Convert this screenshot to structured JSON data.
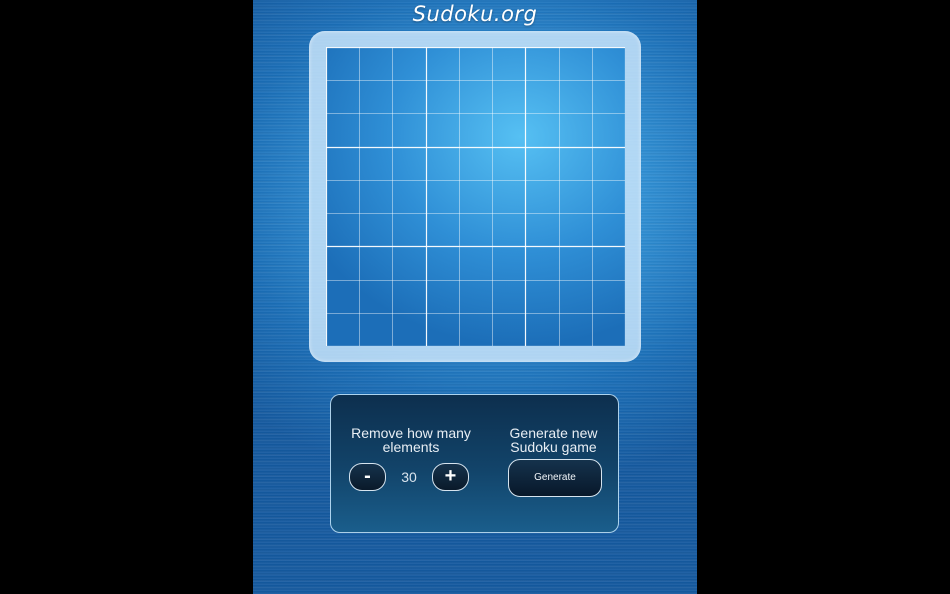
{
  "app": {
    "title": "Sudoku.org"
  },
  "board": {
    "rows": 9,
    "cols": 9,
    "cells": [
      [
        "",
        "",
        "",
        "",
        "",
        "",
        "",
        "",
        ""
      ],
      [
        "",
        "",
        "",
        "",
        "",
        "",
        "",
        "",
        ""
      ],
      [
        "",
        "",
        "",
        "",
        "",
        "",
        "",
        "",
        ""
      ],
      [
        "",
        "",
        "",
        "",
        "",
        "",
        "",
        "",
        ""
      ],
      [
        "",
        "",
        "",
        "",
        "",
        "",
        "",
        "",
        ""
      ],
      [
        "",
        "",
        "",
        "",
        "",
        "",
        "",
        "",
        ""
      ],
      [
        "",
        "",
        "",
        "",
        "",
        "",
        "",
        "",
        ""
      ],
      [
        "",
        "",
        "",
        "",
        "",
        "",
        "",
        "",
        ""
      ],
      [
        "",
        "",
        "",
        "",
        "",
        "",
        "",
        "",
        ""
      ]
    ]
  },
  "controls": {
    "remove_label": "Remove how many elements",
    "minus_label": "-",
    "plus_label": "+",
    "count_value": "30",
    "generate_label": "Generate new Sudoku game",
    "generate_button_label": "Generate"
  },
  "colors": {
    "background": "#000000",
    "app_blue": "#2f8ed3",
    "frame": "#c8e4fa",
    "panel": "#12446a",
    "grid_line": "#ffffff"
  }
}
